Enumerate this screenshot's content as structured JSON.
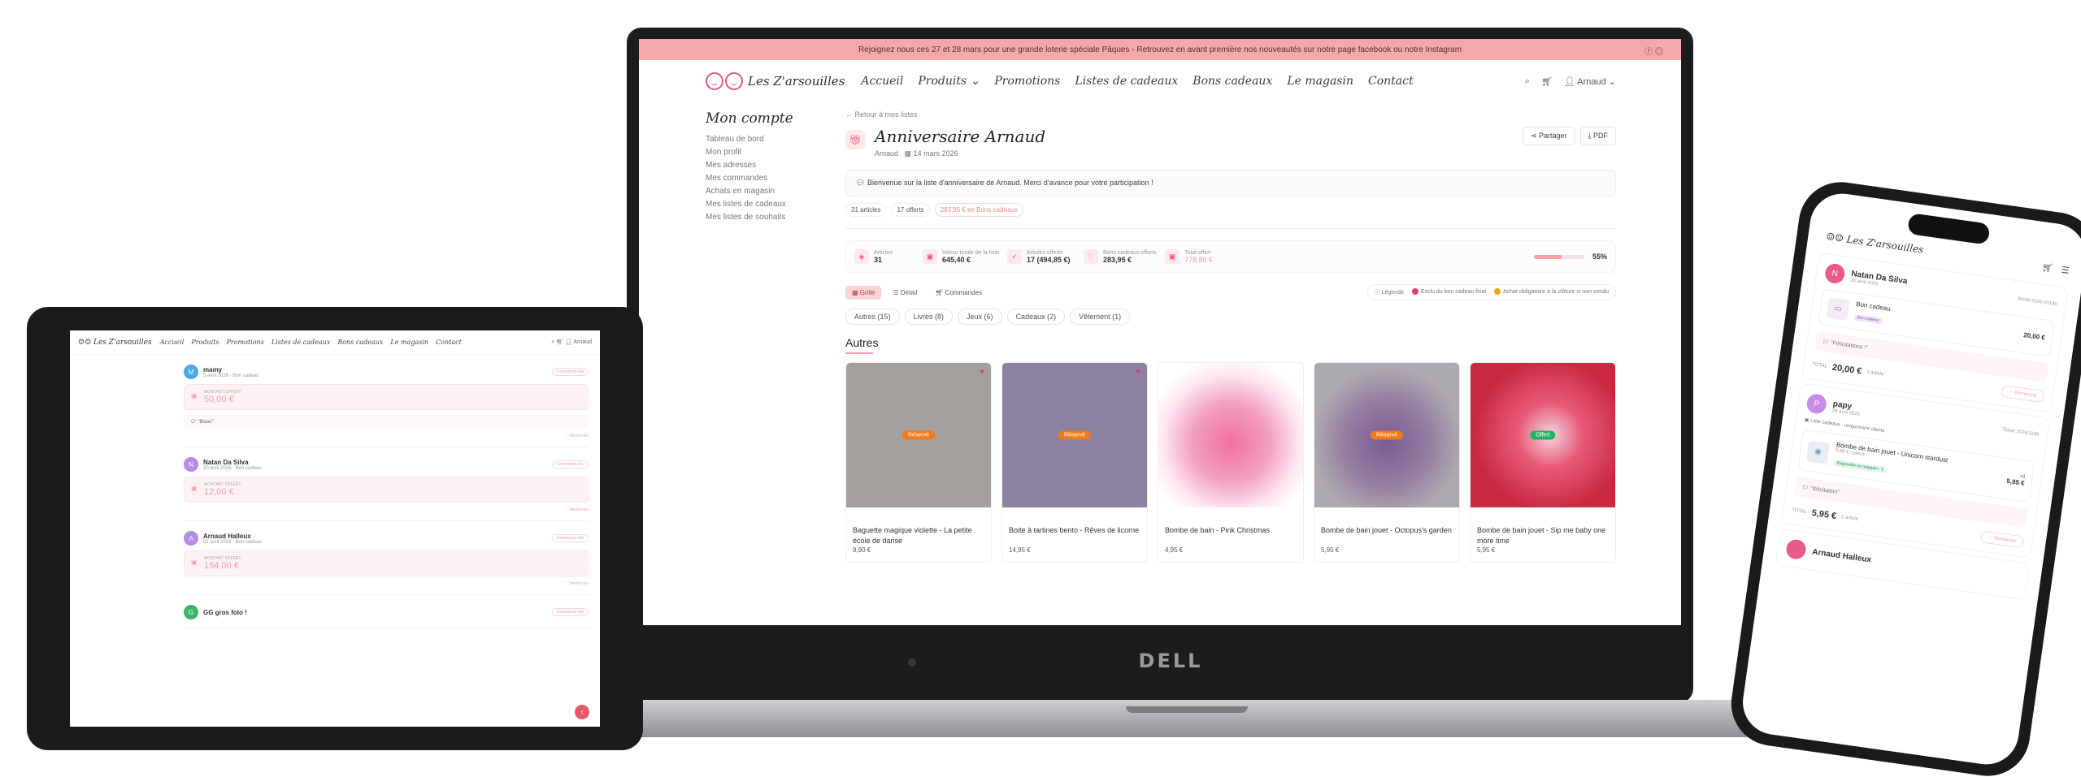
{
  "laptop": {
    "brand": "DELL",
    "promo": "Rejoignez nous ces 27 et 28 mars pour une grande loterie spéciale Pâques - Retrouvez en avant première nos nouveautés sur notre page facebook ou notre Instagram",
    "logo_text": "Les Z'arsouilles",
    "nav": [
      "Accueil",
      "Produits",
      "Promotions",
      "Listes de cadeaux",
      "Bons cadeaux",
      "Le magasin",
      "Contact"
    ],
    "user": "Arnaud",
    "sidebar_title": "Mon compte",
    "sidebar": [
      "Tableau de bord",
      "Mon profil",
      "Mes adresses",
      "Mes commandes",
      "Achats en magasin",
      "Mes listes de cadeaux",
      "Mes listes de souhaits"
    ],
    "back": "Retour à mes listes",
    "list_title": "Anniversaire Arnaud",
    "owner": "Arnaud",
    "date": "14 mars 2026",
    "share": "Partager",
    "pdf": "PDF",
    "welcome": "Bienvenue sur la liste d'anniversaire de Arnaud. Merci d'avance pour votre participation !",
    "chips": [
      "31 articles",
      "17 offerts",
      "283,95 € en Bons cadeaux"
    ],
    "stats": [
      {
        "label": "Articles",
        "value": "31"
      },
      {
        "label": "Valeur totale de la liste",
        "value": "645,40 €"
      },
      {
        "label": "Articles offerts",
        "value": "17 (494,85 €)"
      },
      {
        "label": "Bons cadeaux offerts",
        "value": "283,95 €"
      },
      {
        "label": "Total offert",
        "value": "778,80 €"
      }
    ],
    "progress_pct": 55,
    "progress_label": "55%",
    "views": [
      "Grille",
      "Détail",
      "Commandes"
    ],
    "legend": [
      "Légende",
      "Exclu du bon cadeau final",
      "Achat obligatoire à la clôture si non vendu"
    ],
    "filters": [
      "Autres (15)",
      "Livres (8)",
      "Jeux (6)",
      "Cadeaux (2)",
      "Vêtement (1)"
    ],
    "section": "Autres",
    "products": [
      {
        "name": "Baguette magique violette - La petite école de danse",
        "price": "9,90 €",
        "badge": "Réservé",
        "color": "#d9d4d2"
      },
      {
        "name": "Boite à tartines bento - Rêves de licorne",
        "price": "14,95 €",
        "badge": "Réservé",
        "color": "#b9a8d8"
      },
      {
        "name": "Bombe de bain - Pink Christmas",
        "price": "4,95 €",
        "badge": "",
        "color": "#f3b7cf"
      },
      {
        "name": "Bombe de bain jouet - Octopus's garden",
        "price": "5,95 €",
        "badge": "Réservé",
        "color": "#c7a2d8"
      },
      {
        "name": "Bombe de bain jouet - Sip me baby one more time",
        "price": "5,95 €",
        "badge": "Offert",
        "color": "#d2334a"
      }
    ]
  },
  "tablet": {
    "logo_text": "Les Z'arsouilles",
    "nav": [
      "Accueil",
      "Produits",
      "Promotions",
      "Listes de cadeaux",
      "Bons cadeaux",
      "Le magasin",
      "Contact"
    ],
    "user": "Arnaud",
    "amount_label": "MONTANT OFFERT",
    "tag": "Commande liée",
    "thank": "Remercier",
    "entries": [
      {
        "initial": "M",
        "name": "mamy",
        "date": "5 avril 2026 · Bon cadeau",
        "amount": "50,00 €",
        "msg": "Bisou",
        "color": "#4aa8e8"
      },
      {
        "initial": "N",
        "name": "Natan Da Silva",
        "date": "20 avril 2026 · Bon cadeau",
        "amount": "12,00 €",
        "msg": "",
        "color": "#b58be8"
      },
      {
        "initial": "A",
        "name": "Arnaud Halleux",
        "date": "21 avril 2026 · Bon cadeau",
        "amount": "154,00 €",
        "msg": "",
        "color": "#b58be8"
      },
      {
        "initial": "G",
        "name": "GG gros folo !",
        "date": "",
        "amount": "",
        "msg": "",
        "color": "#39b36a"
      }
    ]
  },
  "phone": {
    "logo_text": "Les Z'arsouilles",
    "cards": [
      {
        "initial": "N",
        "name": "Natan Da Silva",
        "date": "20 avril 2026",
        "ticket": "BV09-2026-00180",
        "item": "Bon cadeau",
        "pill": "Bon cadeau",
        "item_price": "20,00 €",
        "msg": "Félicitations !",
        "total_lbl": "TOTAL",
        "total": "20,00 €",
        "count": "1 article",
        "color": "#e85a8a"
      },
      {
        "initial": "P",
        "name": "papy",
        "date": "28 avril 2026",
        "ticket": "Ticket 2026/1168",
        "note": "Liste cadeaux : uniquement clients",
        "item": "Bombe de bain jouet - Unicorn stardust",
        "pill": "Disponible en magasin : 1",
        "item_price": "5,95 €",
        "unit": "5,95 € / pièce",
        "qty": "×1",
        "msg": "félicitation",
        "total_lbl": "TOTAL",
        "total": "5,95 €",
        "count": "1 article",
        "color": "#c98be8"
      }
    ],
    "thank": "Remercier",
    "next_name": "Arnaud Halleux"
  }
}
